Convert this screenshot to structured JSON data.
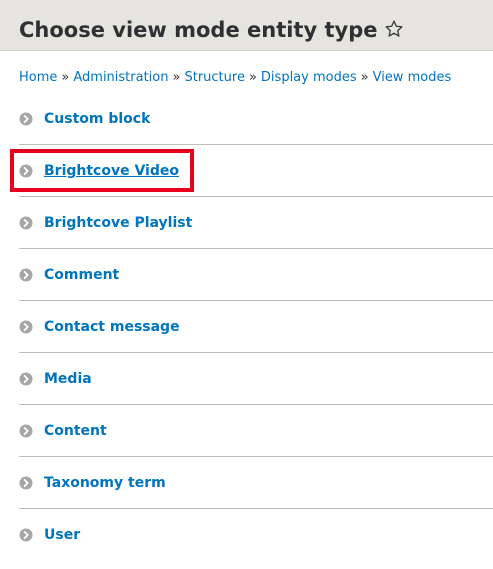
{
  "header": {
    "title": "Choose view mode entity type",
    "shortcut_icon": "star-outline-icon"
  },
  "breadcrumb": [
    "Home",
    "Administration",
    "Structure",
    "Display modes",
    "View modes"
  ],
  "breadcrumb_separator": "»",
  "entity_types": [
    {
      "label": "Custom block",
      "focused": false
    },
    {
      "label": "Brightcove Video",
      "focused": true
    },
    {
      "label": "Brightcove Playlist",
      "focused": false
    },
    {
      "label": "Comment",
      "focused": false
    },
    {
      "label": "Contact message",
      "focused": false
    },
    {
      "label": "Media",
      "focused": false
    },
    {
      "label": "Content",
      "focused": false
    },
    {
      "label": "Taxonomy term",
      "focused": false
    },
    {
      "label": "User",
      "focused": false
    }
  ],
  "colors": {
    "link": "#0074bd",
    "header_bg": "#e6e4df",
    "title": "#2f3033",
    "arrow_icon": "#a6a6a6",
    "highlight": "#e8001c",
    "divider": "#bfbfba"
  }
}
